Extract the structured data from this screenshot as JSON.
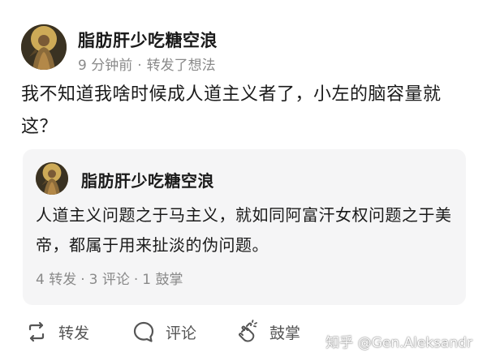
{
  "post": {
    "author": "脂肪肝少吃糖空浪",
    "time": "9 分钟前",
    "action": "转发了想法",
    "text": "我不知道我啥时候成人道主义者了，小左的脑容量就这？"
  },
  "quoted": {
    "author": "脂肪肝少吃糖空浪",
    "text": "人道主义问题之于马主义，就如同阿富汗女权问题之于美帝，都属于用来扯淡的伪问题。",
    "stats": {
      "reposts": "4 转发",
      "comments": "3 评论",
      "claps": "1 鼓掌"
    }
  },
  "actions": {
    "repost": "转发",
    "comment": "评论",
    "clap": "鼓掌"
  },
  "watermark": "知乎 @Gen.Aleksandr",
  "icons": {
    "repost": "repost-icon",
    "comment": "comment-icon",
    "clap": "clap-icon"
  },
  "colors": {
    "background": "#ffffff",
    "quote_background": "#f5f5f6",
    "meta_text": "#8a8a8a",
    "body_text": "#1a1a1a"
  }
}
